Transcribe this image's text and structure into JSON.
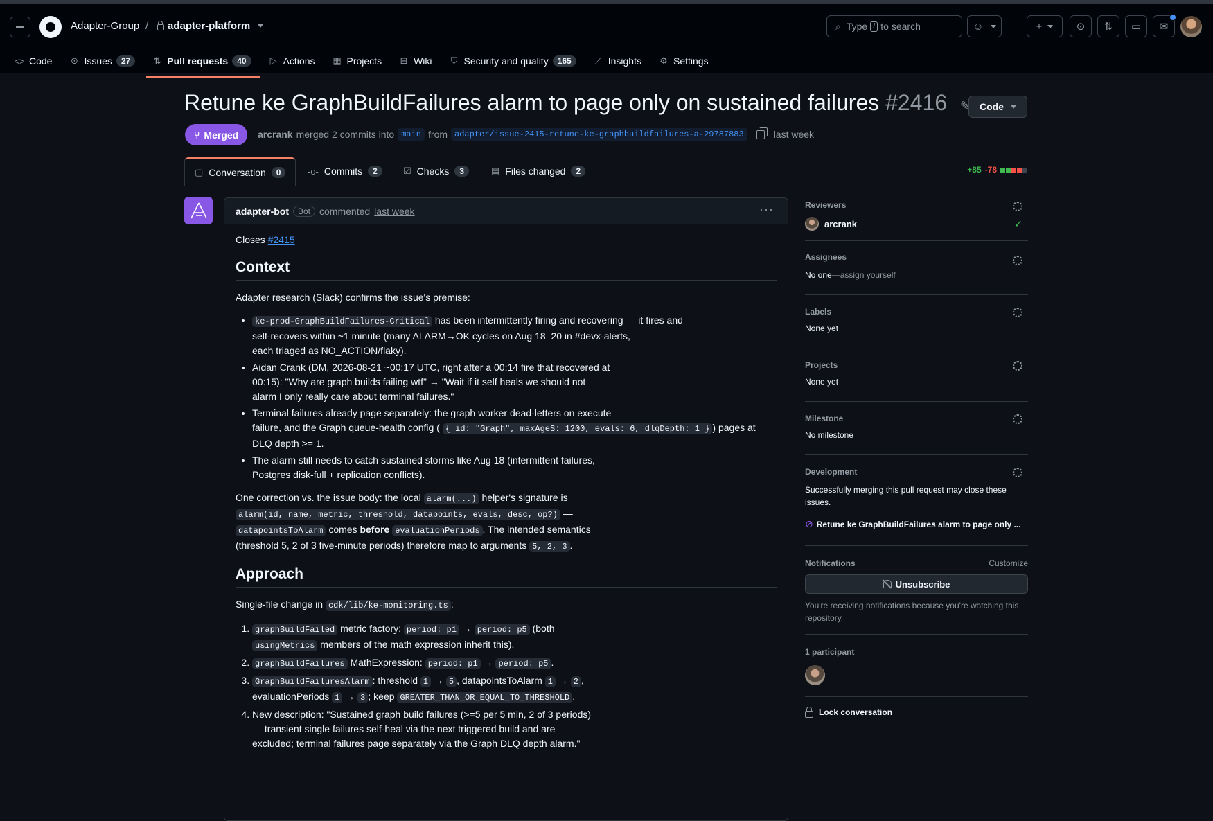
{
  "header": {
    "org": "Adapter-Group",
    "separator": "/",
    "repo": "adapter-platform",
    "search_placeholder_pre": "Type",
    "search_key": "/",
    "search_placeholder_post": "to search"
  },
  "nav": {
    "code": "Code",
    "issues": "Issues",
    "issues_count": "27",
    "pull_requests": "Pull requests",
    "pull_requests_count": "40",
    "actions": "Actions",
    "projects": "Projects",
    "wiki": "Wiki",
    "security": "Security and quality",
    "security_count": "165",
    "insights": "Insights",
    "settings": "Settings"
  },
  "pr": {
    "title": "Retune ke GraphBuildFailures alarm to page only on sustained failures",
    "number": "#2416",
    "code_button": "Code",
    "state": "Merged",
    "author": "arcrank",
    "merged_text": "merged 2 commits into",
    "base_branch": "main",
    "from_text": "from",
    "head_branch": "adapter/issue-2415-retune-ke-graphbuildfailures-a-29787883",
    "time": "last week"
  },
  "tabs": {
    "conversation": "Conversation",
    "conversation_count": "0",
    "commits": "Commits",
    "commits_count": "2",
    "checks": "Checks",
    "checks_count": "3",
    "files": "Files changed",
    "files_count": "2",
    "additions": "+85",
    "deletions": "-78"
  },
  "comment": {
    "author": "adapter-bot",
    "bot_label": "Bot",
    "action": "commented",
    "time": "last week",
    "closes_text": "Closes",
    "closes_issue": "#2415",
    "context_heading": "Context",
    "context_intro": "Adapter research (Slack) confirms the issue's premise:",
    "b1_code": "ke-prod-GraphBuildFailures-Critical",
    "b1_text_a": " has been intermittently firing and recovering — it fires and",
    "b1_text_b": "self-recovers within ~1 minute (many ALARM→OK cycles on Aug 18–20 in #devx-alerts,",
    "b1_text_c": "each triaged as NO_ACTION/flaky).",
    "b2_text_a": "Aidan Crank (DM, 2026-08-21 ~00:17 UTC, right after a 00:14 fire that recovered at",
    "b2_text_b": "00:15): \"Why are graph builds failing wtf\" → \"Wait if it self heals we should not",
    "b2_text_c": "alarm I only really care about terminal failures.\"",
    "b3_text_a": "Terminal failures already page separately: the graph worker dead-letters on execute",
    "b3_text_b": "failure, and the Graph queue-health config (",
    "b3_code": "{ id: \"Graph\", maxAgeS: 1200, evals: 6, dlqDepth: 1 }",
    "b3_text_c": ") pages at",
    "b3_text_d": "DLQ depth >= 1.",
    "b4_text_a": "The alarm still needs to catch sustained storms like Aug 18 (intermittent failures,",
    "b4_text_b": "Postgres disk-full + replication conflicts).",
    "corr_a": "One correction vs. the issue body: the local",
    "corr_code1": "alarm(...)",
    "corr_b": "helper's signature is",
    "corr_code2": "alarm(id, name, metric, threshold, datapoints, evals, desc, op?)",
    "corr_c": " —",
    "corr_code3": "datapointsToAlarm",
    "corr_d": "comes",
    "corr_bold": "before",
    "corr_code4": "evaluationPeriods",
    "corr_e": ". The intended semantics",
    "corr_f": "(threshold 5, 2 of 3 five-minute periods) therefore map to arguments",
    "corr_code5": "5, 2, 3",
    "corr_g": ".",
    "approach_heading": "Approach",
    "approach_intro": "Single-file change in",
    "approach_file": "cdk/lib/ke-monitoring.ts",
    "approach_colon": ":",
    "o1_code1": "graphBuildFailed",
    "o1_text1": " metric factory: ",
    "o1_code2": "period: p1",
    "o1_arrow": " → ",
    "o1_code3": "period: p5",
    "o1_text2": " (both",
    "o1_code4": "usingMetrics",
    "o1_text3": " members of the math expression inherit this).",
    "o2_code1": "graphBuildFailures",
    "o2_text1": " MathExpression: ",
    "o2_code2": "period: p1",
    "o2_arrow": " → ",
    "o2_code3": "period: p5",
    "o2_text2": ".",
    "o3_code1": "GraphBuildFailuresAlarm",
    "o3_text1": ": threshold ",
    "o3_code2": "1",
    "o3_arrow1": " → ",
    "o3_code3": "5",
    "o3_text2": ", datapointsToAlarm ",
    "o3_code4": "1",
    "o3_arrow2": " → ",
    "o3_code5": "2",
    "o3_text3": ",",
    "o3_text4": "evaluationPeriods ",
    "o3_code6": "1",
    "o3_arrow3": " → ",
    "o3_code7": "3",
    "o3_text5": "; keep ",
    "o3_code8": "GREATER_THAN_OR_EQUAL_TO_THRESHOLD",
    "o3_text6": ".",
    "o4_text_a": "New description: \"Sustained graph build failures (>=5 per 5 min, 2 of 3 periods)",
    "o4_text_b": "— transient single failures self-heal via the next triggered build and are",
    "o4_text_c": "excluded; terminal failures page separately via the Graph DLQ depth alarm.\""
  },
  "sidebar": {
    "reviewers_title": "Reviewers",
    "reviewer": "arcrank",
    "assignees_title": "Assignees",
    "assignees_none": "No one—",
    "assign_yourself": "assign yourself",
    "labels_title": "Labels",
    "labels_value": "None yet",
    "projects_title": "Projects",
    "projects_value": "None yet",
    "milestone_title": "Milestone",
    "milestone_value": "No milestone",
    "development_title": "Development",
    "development_text": "Successfully merging this pull request may close these issues.",
    "linked_issue": "Retune ke GraphBuildFailures alarm to page only ...",
    "notifications_title": "Notifications",
    "customize": "Customize",
    "unsubscribe": "Unsubscribe",
    "notif_reason": "You're receiving notifications because you're watching this repository.",
    "participants": "1 participant",
    "lock": "Lock conversation"
  },
  "colors": {
    "background": "#0d1117",
    "merged": "#8957e5",
    "link": "#4493f8",
    "additions": "#3fb950",
    "deletions": "#f85149",
    "active_tab": "#f78166"
  }
}
